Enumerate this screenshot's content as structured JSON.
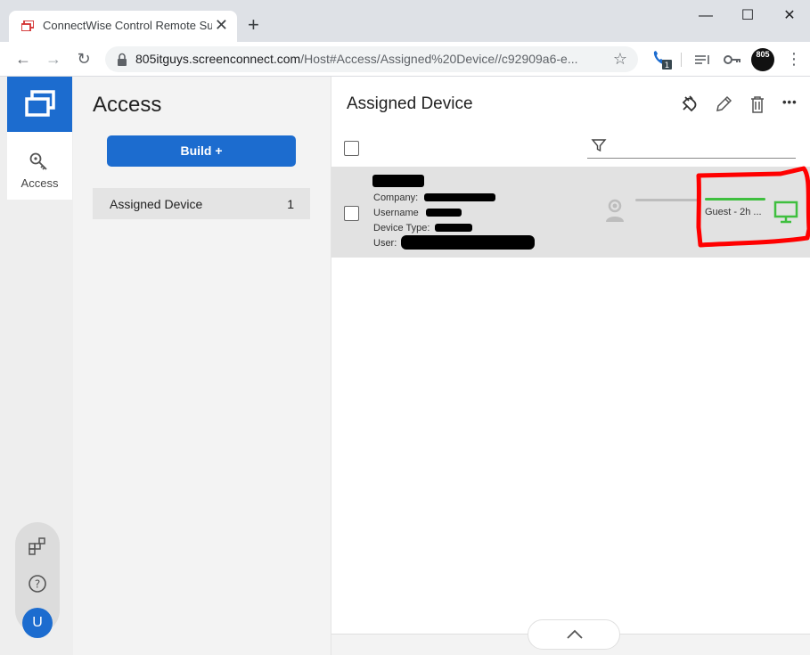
{
  "browser": {
    "tab_title": "ConnectWise Control Remote Su",
    "url_host": "805itguys.screenconnect.com",
    "url_path": "/Host#Access/Assigned%20Device//c92909a6-e...",
    "profile_text": "805"
  },
  "colors": {
    "brand_blue": "#1c6ccf",
    "status_green": "#3fbf3f",
    "annotation_red": "#ff0000"
  },
  "icons": [
    "favicon",
    "close-icon",
    "plus-icon",
    "minimize-icon",
    "maximize-icon",
    "back-icon",
    "forward-icon",
    "reload-icon",
    "lock-icon",
    "star-icon",
    "phone-icon",
    "reading-list-icon",
    "key-icon",
    "kebab-icon",
    "search-key-icon",
    "extras-icon",
    "help-icon",
    "plug-icon",
    "pencil-icon",
    "trash-icon",
    "more-icon",
    "filter-icon",
    "guest-icon",
    "monitor-icon",
    "chevron-up-icon"
  ],
  "rail": {
    "access_label": "Access",
    "avatar_letter": "U"
  },
  "panel": {
    "title": "Access",
    "build_label": "Build +",
    "groups": [
      {
        "label": "Assigned Device",
        "count": "1"
      }
    ]
  },
  "main": {
    "title": "Assigned Device",
    "more_label": "•••",
    "session": {
      "company_label": "Company:",
      "username_label": "Username",
      "device_type_label": "Device Type:",
      "user_label": "User:",
      "guest_status": "Guest - 2h ..."
    }
  }
}
